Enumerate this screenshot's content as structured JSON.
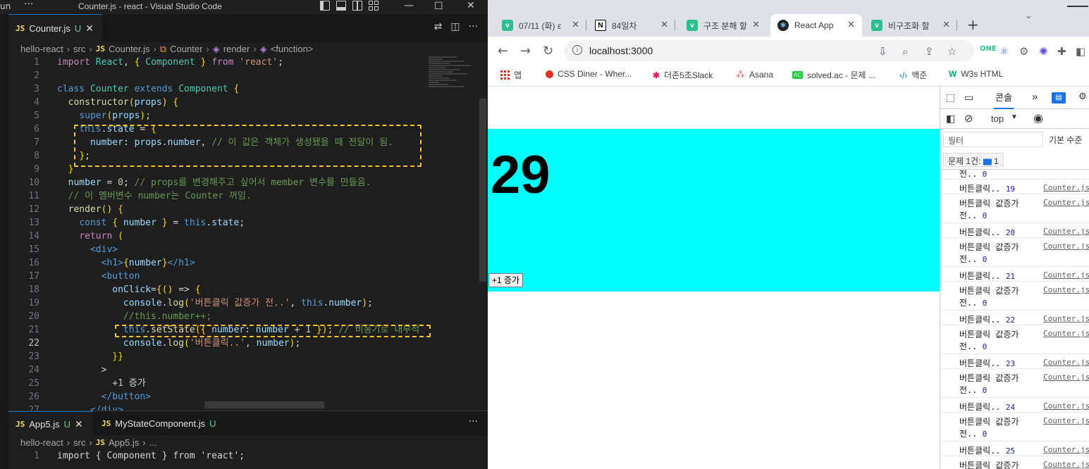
{
  "vscode": {
    "title_left": "un",
    "menu": "···",
    "window_title": "Counter.js - react - Visual Studio Code",
    "tabs": [
      {
        "file": "Counter.js",
        "badge": "JS",
        "status": "U"
      }
    ],
    "breadcrumbs": [
      "hello-react",
      "src",
      "Counter.js",
      "Counter",
      "render",
      "<function>"
    ],
    "current_line": "22",
    "pane2": {
      "tabs": [
        {
          "file": "App5.js",
          "badge": "JS",
          "status": "U"
        },
        {
          "file": "MyStateComponent.js",
          "badge": "JS",
          "status": "U"
        }
      ],
      "breadcrumbs": [
        "hello-react",
        "src",
        "App5.js",
        "..."
      ],
      "line1": "import { Component } from 'react';"
    }
  },
  "code_lines": [
    {
      "n": "1",
      "text": "import React, { Component } from 'react';"
    },
    {
      "n": "2",
      "text": ""
    },
    {
      "n": "3",
      "text": "class Counter extends Component {"
    },
    {
      "n": "4",
      "text": "  constructor(props) {"
    },
    {
      "n": "5",
      "text": "    super(props);"
    },
    {
      "n": "6",
      "text": "    this.state = {"
    },
    {
      "n": "7",
      "text": "      number: props.number, // 이 값은 객체가 생성됐을 때 전달이 됨."
    },
    {
      "n": "8",
      "text": "    };"
    },
    {
      "n": "9",
      "text": "  }"
    },
    {
      "n": "10",
      "text": "  number = 0; // props를 변경해주고 싶어서 member 변수를 만들음."
    },
    {
      "n": "11",
      "text": "  // 이 멤버변수 number는 Counter 꺼임."
    },
    {
      "n": "12",
      "text": "  render() {"
    },
    {
      "n": "13",
      "text": "    const { number } = this.state;"
    },
    {
      "n": "14",
      "text": "    return ("
    },
    {
      "n": "15",
      "text": "      <div>"
    },
    {
      "n": "16",
      "text": "        <h1>{number}</h1>"
    },
    {
      "n": "17",
      "text": "        <button"
    },
    {
      "n": "18",
      "text": "          onClick={() => {"
    },
    {
      "n": "19",
      "text": "            console.log('버튼클릭 값증가 전..', this.number);"
    },
    {
      "n": "20",
      "text": "            //this.number++;"
    },
    {
      "n": "21",
      "text": "            this.setState({ number: number + 1 }); // 비동기로 내부적"
    },
    {
      "n": "22",
      "text": "            console.log('버튼클릭..', number);"
    },
    {
      "n": "23",
      "text": "          }}"
    },
    {
      "n": "24",
      "text": "        >"
    },
    {
      "n": "25",
      "text": "          +1 증가"
    },
    {
      "n": "26",
      "text": "        </button>"
    },
    {
      "n": "27",
      "text": "      </div>"
    }
  ],
  "chrome": {
    "tabs": [
      {
        "title": "07/11 (화) ε",
        "icon": "velog-icon",
        "active": false
      },
      {
        "title": "84일차",
        "icon": "notion-icon",
        "active": false
      },
      {
        "title": "구조 분해 할",
        "icon": "velog-icon",
        "active": false
      },
      {
        "title": "React App",
        "icon": "react-icon",
        "active": true
      },
      {
        "title": "비구조화 할",
        "icon": "velog-icon",
        "active": false
      }
    ],
    "url": "localhost:3000",
    "bookmarks": [
      "앱",
      "CSS Diner - Wher...",
      "더존5조Slack",
      "Asana",
      "solved.ac - 문제 ...",
      "백준",
      "W3s HTML"
    ]
  },
  "app": {
    "count": "29",
    "button_label": "+1 증가",
    "background_color": "#00ffff"
  },
  "devtools": {
    "console_tab": "콘솔",
    "context": "top",
    "filter_placeholder": "필터",
    "levels": "기본 수준",
    "issues": "문제 1건:",
    "issues_count": "1",
    "logs": [
      {
        "msg": "전..",
        "val": "0",
        "src": ""
      },
      {
        "msg": "버튼클릭..",
        "val": "19",
        "src": "Counter.js"
      },
      {
        "msg": "버튼클릭 값증가",
        "msg2": "전..",
        "val": "0",
        "src": "Counter.js"
      },
      {
        "msg": "버튼클릭..",
        "val": "20",
        "src": "Counter.js"
      },
      {
        "msg": "버튼클릭 값증가",
        "msg2": "전..",
        "val": "0",
        "src": "Counter.js"
      },
      {
        "msg": "버튼클릭..",
        "val": "21",
        "src": "Counter.js"
      },
      {
        "msg": "버튼클릭 값증가",
        "msg2": "전..",
        "val": "0",
        "src": "Counter.js"
      },
      {
        "msg": "버튼클릭..",
        "val": "22",
        "src": "Counter.js"
      },
      {
        "msg": "버튼클릭 값증가",
        "msg2": "전..",
        "val": "0",
        "src": "Counter.js"
      },
      {
        "msg": "버튼클릭..",
        "val": "23",
        "src": "Counter.js"
      },
      {
        "msg": "버튼클릭 값증가",
        "msg2": "전..",
        "val": "0",
        "src": "Counter.js"
      },
      {
        "msg": "버튼클릭..",
        "val": "24",
        "src": "Counter.js"
      },
      {
        "msg": "버튼클릭 값증가",
        "msg2": "전..",
        "val": "0",
        "src": "Counter.js"
      },
      {
        "msg": "버튼클릭..",
        "val": "25",
        "src": "Counter.js"
      },
      {
        "msg": "버튼클릭 값증가",
        "msg2": "",
        "val": "",
        "src": "Counter.js"
      }
    ]
  }
}
